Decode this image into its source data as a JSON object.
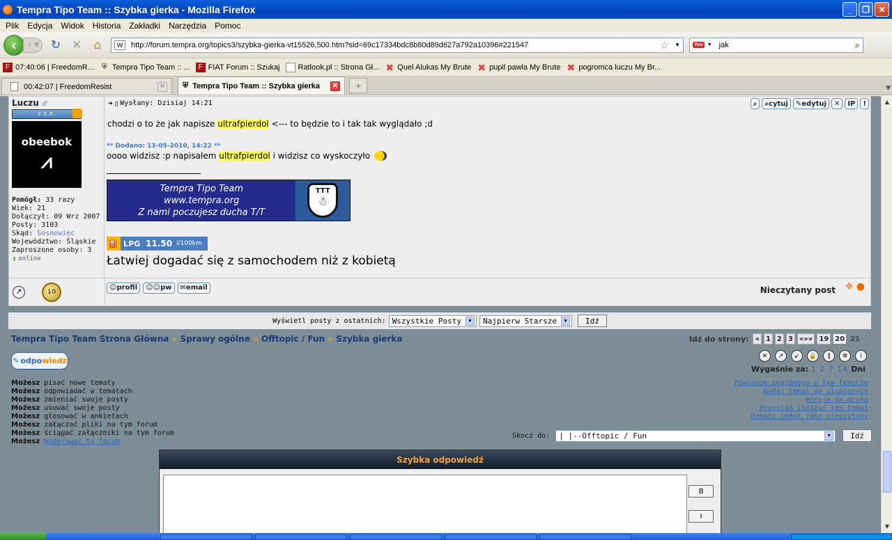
{
  "window": {
    "title": "Tempra Tipo Team :: Szybka gierka - Mozilla Firefox"
  },
  "menu": [
    "Plik",
    "Edycja",
    "Widok",
    "Historia",
    "Zakładki",
    "Narzędzia",
    "Pomoc"
  ],
  "nav": {
    "url": "http://forum.tempra.org/topics3/szybka-gierka-vt15526,500.htm?sid=69c17334bdc8b80d89d627a792a10396#221547",
    "search_query": "jak"
  },
  "bookmarks": [
    "07:40:06 | FreedomR...",
    "Tempra Tipo Team :: ...",
    "FIAT Forum :: Szukaj",
    "Ratlook.pl :: Strona Gł...",
    "Quel Alukas My Brute",
    "pupil pawla My Brute",
    "pogromca luczu My Br..."
  ],
  "tabs": [
    {
      "label": "00:42:07 | FreedomResist",
      "active": false
    },
    {
      "label": "Tempra Tipo Team :: Szybka gierka",
      "active": true
    }
  ],
  "post": {
    "author": "Luczu",
    "rank_badge": "V.I.P.",
    "avatar_text": "obeebok",
    "stats": [
      {
        "k": "Pomógł:",
        "v": "33 razy"
      },
      {
        "k": "Wiek:",
        "v": "21"
      },
      {
        "k": "Dołączył:",
        "v": "09 Wrz 2007"
      },
      {
        "k": "Posty:",
        "v": "3103"
      },
      {
        "k": "Skąd:",
        "v": "Sosnowiec"
      },
      {
        "k": "Województwo:",
        "v": "Śląskie"
      },
      {
        "k": "Zaproszone osoby:",
        "v": "3"
      }
    ],
    "status": "online",
    "posted": "Wysłany: Dzisiaj 14:21",
    "buttons": [
      "cytuj",
      "edytuj"
    ],
    "line1_before": "chodzi o to że jak napisze ",
    "highlight_word": "ultrafpierdol",
    "line1_after": " <--- to będzie to i tak tak wyglądało ;d",
    "added": "** Dodano: 13-05-2010, 14:22 **",
    "line2_before": "oooo widzisz :p napisałem ",
    "line2_after": " i widzisz co wyskoczyło",
    "banner": [
      "Tempra Tipo Team",
      "www.tempra.org",
      "Z nami poczujesz ducha T/T"
    ],
    "banner_logo": "TTT",
    "lpg": {
      "label": "LPG",
      "value": "11.50",
      "unit": "l/100km"
    },
    "motto": "Łatwiej dogadać się z samochodem niż z kobietą",
    "medal": "10",
    "footer_buttons": [
      "profil",
      "pw",
      "email"
    ],
    "unread_label": "Nieczytany post"
  },
  "post_options": {
    "label": "Wyświetl posty z ostatnich:",
    "range": "Wszystkie Posty",
    "order": "Najpierw Starsze",
    "go": "Idź"
  },
  "breadcrumbs": [
    "Tempra Tipo Team Strona Główna",
    "Sprawy ogólne",
    "Offtopic / Fun",
    "Szybka gierka"
  ],
  "pagination": {
    "label": "Idź do strony:",
    "pages": [
      "«",
      "1",
      "2",
      "3",
      "«»»",
      "19",
      "20",
      "21"
    ],
    "current": "20"
  },
  "reply_button": {
    "a": "odpo",
    "b": "wiedz"
  },
  "expire": {
    "label": "Wygaśnie za:",
    "values": "1 2 7 14",
    "unit": "Dni"
  },
  "permissions": [
    {
      "k": "Możesz",
      "v": "pisać nowe tematy"
    },
    {
      "k": "Możesz",
      "v": "odpowiadać w tematach"
    },
    {
      "k": "Możesz",
      "v": "zmieniać swoje posty"
    },
    {
      "k": "Możesz",
      "v": "usuwać swoje posty"
    },
    {
      "k": "Możesz",
      "v": "głosować w ankietach"
    },
    {
      "k": "Możesz",
      "v": "załączać pliki na tym forum"
    },
    {
      "k": "Możesz",
      "v": "ściągać załączniki na tym forum"
    },
    {
      "k": "Możesz",
      "v": "moderować to forum"
    }
  ],
  "topic_links": [
    "Powiadom znajomego o tym temacie",
    "Dodaj temat do ulubionych",
    "Wersja do druku",
    "Przestań śledzić ten temat",
    "Oznacz temat jako nieczytany"
  ],
  "jump": {
    "label": "Skocz do:",
    "value": "|   |--Offtopic / Fun",
    "go": "Idź"
  },
  "quick_reply": {
    "title": "Szybka odpowiedź",
    "b": "B",
    "i": "I"
  }
}
